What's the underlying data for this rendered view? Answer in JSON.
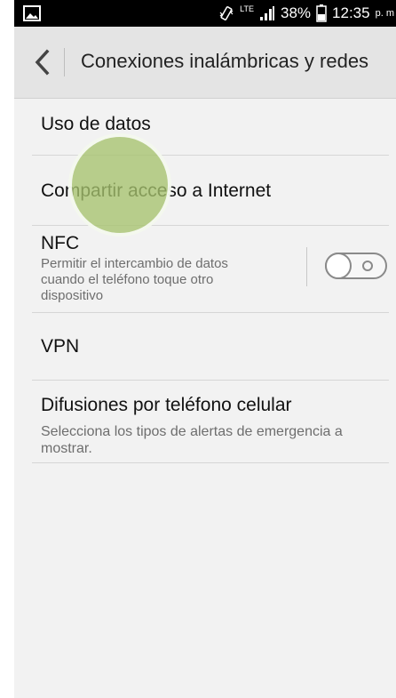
{
  "status_bar": {
    "lte": "LTE",
    "battery": "38%",
    "time": "12:35",
    "ampm": "p. m"
  },
  "action_bar": {
    "title": "Conexiones inalámbricas y redes"
  },
  "settings": {
    "data_usage": {
      "title": "Uso de datos"
    },
    "tethering": {
      "title": "Compartir acceso a Internet"
    },
    "nfc": {
      "title": "NFC",
      "subtitle": "Permitir el intercambio de datos cuando el teléfono toque otro dispositivo",
      "toggle_on": false
    },
    "vpn": {
      "title": "VPN"
    },
    "cell_broadcast": {
      "title": "Difusiones por teléfono celular",
      "subtitle": "Selecciona los tipos de alertas de emergencia a mostrar."
    }
  },
  "icons": {
    "gallery": "image-icon",
    "vibrate": "vibrate-icon",
    "signal": "signal-icon",
    "battery": "battery-icon",
    "back": "chevron-left-icon"
  }
}
